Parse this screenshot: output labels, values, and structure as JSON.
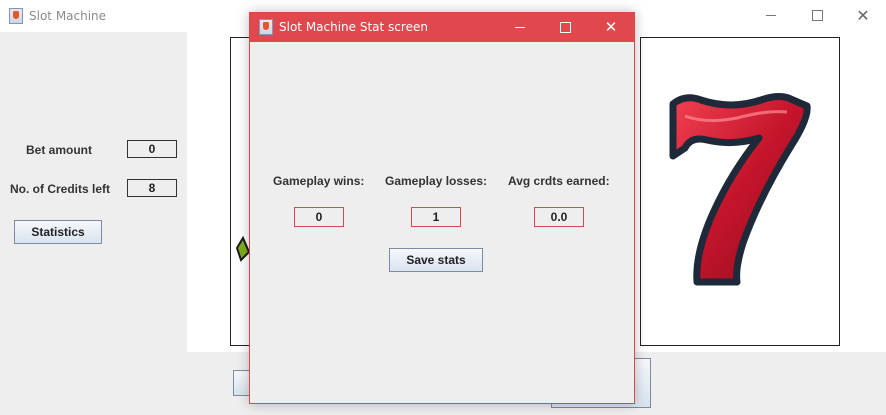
{
  "main_window": {
    "title": "Slot Machine",
    "bet_amount_label": "Bet amount",
    "bet_amount_value": "0",
    "credits_label": "No. of Credits left",
    "credits_value": "8",
    "statistics_button": "Statistics",
    "reels": [
      "lemon-symbol",
      "seven-symbol"
    ]
  },
  "dialog": {
    "title": "Slot Machine Stat screen",
    "wins_label": "Gameplay wins:",
    "wins_value": "0",
    "losses_label": "Gameplay losses:",
    "losses_value": "1",
    "avg_label": "Avg crdts earned:",
    "avg_value": "0.0",
    "save_button": "Save stats"
  },
  "colors": {
    "dialog_titlebar": "#e0484d",
    "seven_red": "#c4142b",
    "seven_outline": "#1e2a3a"
  }
}
